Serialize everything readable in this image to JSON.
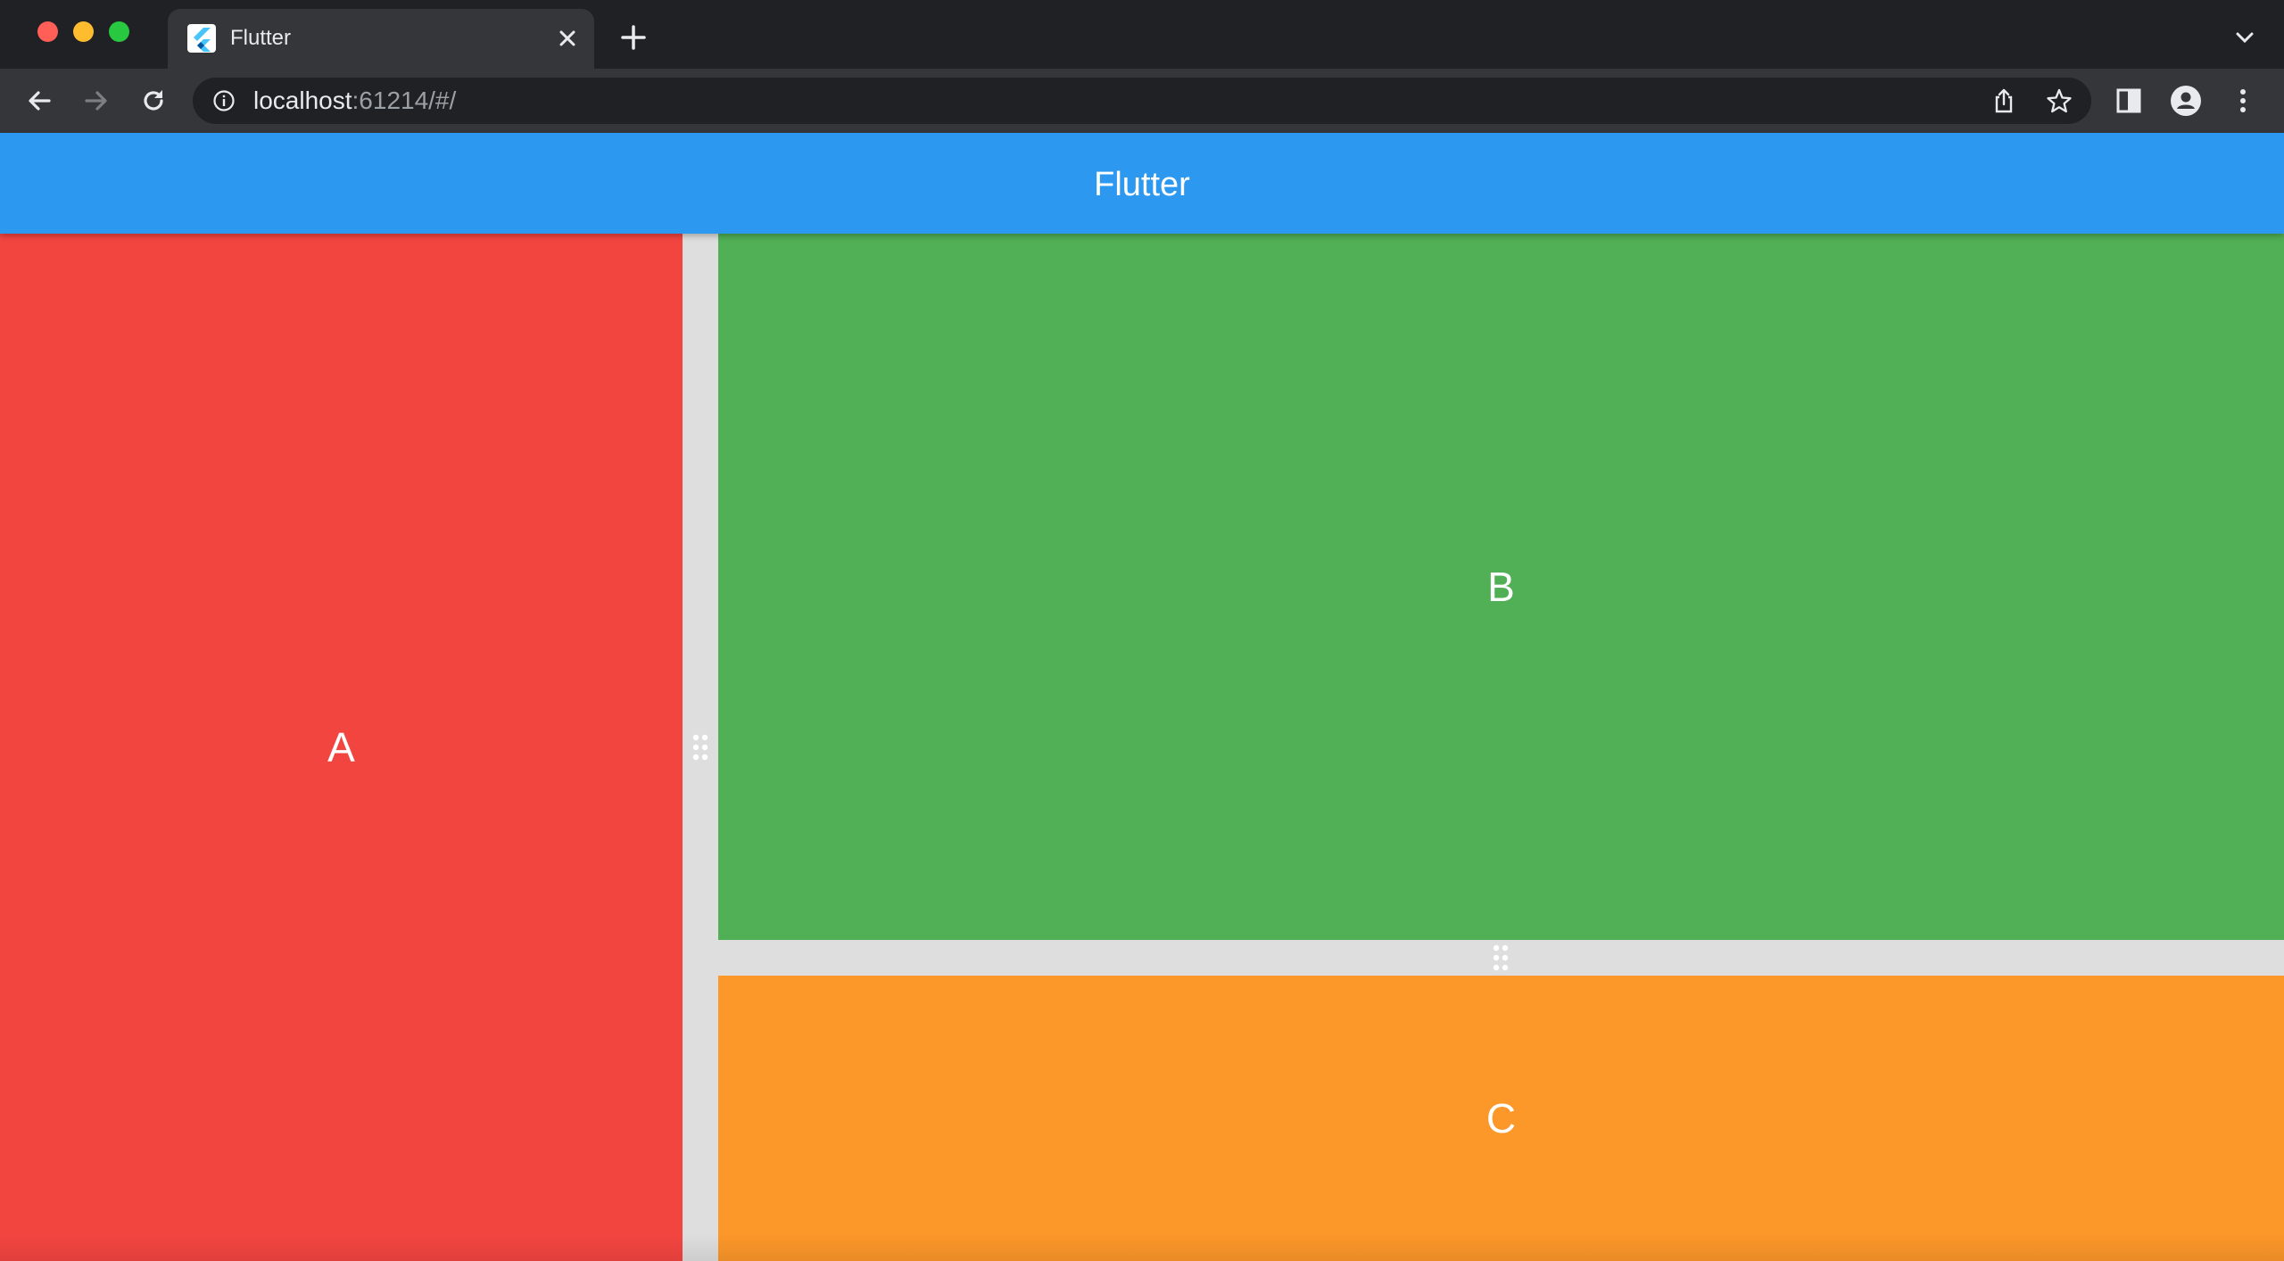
{
  "browser": {
    "tab": {
      "title": "Flutter",
      "favicon": "flutter-logo-icon"
    },
    "address": {
      "host": "localhost",
      "rest": ":61214/#/"
    },
    "icons": {
      "back": "arrow-left-icon",
      "forward": "arrow-right-icon",
      "reload": "reload-icon",
      "info": "info-icon",
      "share": "share-icon",
      "bookmark": "star-icon",
      "side_panel": "side-panel-icon",
      "profile": "profile-icon",
      "menu": "kebab-menu-icon"
    }
  },
  "app": {
    "title": "Flutter",
    "panes": {
      "a": {
        "label": "A",
        "color": "#f34540"
      },
      "b": {
        "label": "B",
        "color": "#51b055"
      },
      "c": {
        "label": "C",
        "color": "#fc9729"
      }
    },
    "appbar_color": "#2c98f0",
    "divider_color": "#dedede"
  }
}
